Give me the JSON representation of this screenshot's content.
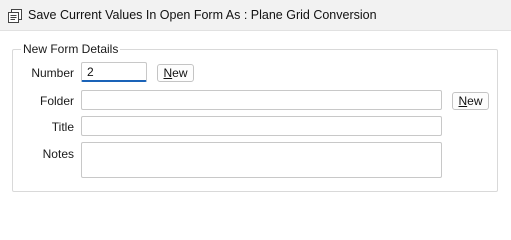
{
  "window": {
    "title": "Save Current Values In Open Form As : Plane Grid Conversion",
    "icon": "form-save-icon"
  },
  "group": {
    "legend": "New Form Details"
  },
  "fields": {
    "number": {
      "label": "Number",
      "value": "2"
    },
    "folder": {
      "label": "Folder",
      "value": ""
    },
    "title": {
      "label": "Title",
      "value": ""
    },
    "notes": {
      "label": "Notes",
      "value": ""
    }
  },
  "buttons": {
    "number_new": {
      "mnemonic": "N",
      "rest": "ew"
    },
    "folder_new": {
      "mnemonic": "N",
      "rest": "ew"
    }
  },
  "colors": {
    "titlebar_bg": "#f2f2f2",
    "focus_accent": "#1a63b8"
  }
}
